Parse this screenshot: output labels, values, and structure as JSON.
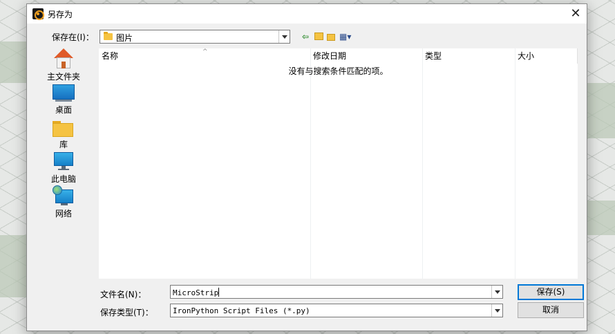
{
  "dialog": {
    "title": "另存为",
    "close_glyph": "✕"
  },
  "save_in": {
    "label": "保存在(I)：",
    "value": "图片"
  },
  "toolbar": {
    "back_glyph": "⇦",
    "up_glyph": "⬑",
    "newfolder_glyph": "✱",
    "view_glyph": "▦▾"
  },
  "places": [
    {
      "label": "主文件夹",
      "icon": "home-icon"
    },
    {
      "label": "桌面",
      "icon": "desktop-icon"
    },
    {
      "label": "库",
      "icon": "library-icon"
    },
    {
      "label": "此电脑",
      "icon": "computer-icon"
    },
    {
      "label": "网络",
      "icon": "network-icon"
    }
  ],
  "list": {
    "columns": [
      "名称",
      "修改日期",
      "类型",
      "大小"
    ],
    "empty_message": "没有与搜索条件匹配的项。"
  },
  "filename": {
    "label": "文件名(N)：",
    "value": "MicroStrip"
  },
  "filetype": {
    "label": "保存类型(T)：",
    "value": "IronPython Script Files (*.py)"
  },
  "buttons": {
    "save": "保存(S)",
    "cancel": "取消"
  },
  "colors": {
    "accent": "#0078d7",
    "folder": "#f5c342"
  }
}
